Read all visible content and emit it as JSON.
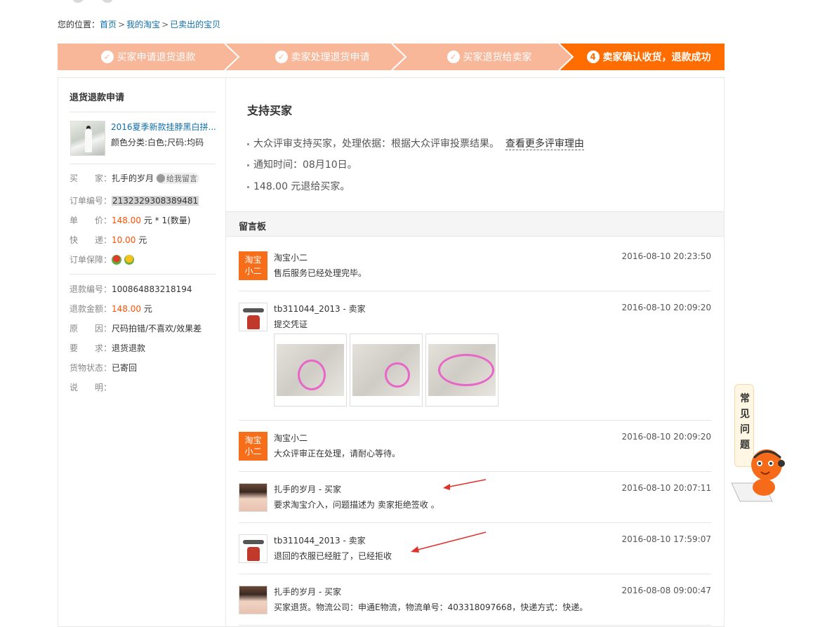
{
  "breadcrumb": {
    "prefix": "您的位置：",
    "items": [
      "首页",
      "我的淘宝",
      "已卖出的宝贝"
    ],
    "separator": ">"
  },
  "steps": [
    {
      "label": "买家申请退货退款",
      "state": "done"
    },
    {
      "label": "卖家处理退货申请",
      "state": "done"
    },
    {
      "label": "买家退货给卖家",
      "state": "done"
    },
    {
      "label": "卖家确认收货，退款成功",
      "state": "active",
      "num": "4"
    }
  ],
  "left": {
    "title": "退货退款申请",
    "product": {
      "title": "2016夏季新款挂脖黑白拼...",
      "spec": "颜色分类:白色;尺码:均码"
    },
    "buyer_label": "买　　家：",
    "buyer_value": "扎手的岁月",
    "msg_button": "给我留言",
    "order_no_label": "订单编号：",
    "order_no": "2132329308389481",
    "unit_price_label": "单　　价：",
    "unit_price": "148.00",
    "unit_price_suffix": "元 * 1(数量)",
    "shipping_label": "快　　递：",
    "shipping": "10.00",
    "shipping_suffix": "元",
    "guarantee_label": "订单保障：",
    "refund_no_label": "退款编号：",
    "refund_no": "100864883218194",
    "refund_amount_label": "退款金额：",
    "refund_amount": "148.00",
    "refund_amount_suffix": "元",
    "reason_label": "原　　因：",
    "reason": "尺码拍错/不喜欢/效果差",
    "request_label": "要　　求：",
    "request": "退货退款",
    "goods_status_label": "货物状态：",
    "goods_status": "已寄回",
    "desc_label": "说　　明：",
    "desc": ""
  },
  "result": {
    "title": "支持买家",
    "line1": "大众评审支持买家，处理依据：根据大众评审投票结果。",
    "line1_link": "查看更多评审理由",
    "line2": "通知时间：08月10日。",
    "line3": "148.00 元退给买家。"
  },
  "board": {
    "title": "留言板",
    "messages": [
      {
        "avatar": "淘宝小二",
        "avatar_l1": "淘宝",
        "avatar_l2": "小二",
        "name": "淘宝小二",
        "time": "2016-08-10 20:23:50",
        "text": "售后服务已经处理完毕。"
      },
      {
        "name": "tb311044_2013 - 卖家",
        "time": "2016-08-10 20:09:20",
        "text": "提交凭证"
      },
      {
        "avatar_l1": "淘宝",
        "avatar_l2": "小二",
        "name": "淘宝小二",
        "time": "2016-08-10 20:09:20",
        "text": "大众评审正在处理，请耐心等待。"
      },
      {
        "name": "扎手的岁月 - 买家",
        "time": "2016-08-10 20:07:11",
        "text": "要求淘宝介入，问题描述为 卖家拒绝签收 。"
      },
      {
        "name": "tb311044_2013 - 卖家",
        "time": "2016-08-10 17:59:07",
        "text": "退回的衣服已经脏了，已经拒收"
      },
      {
        "name": "扎手的岁月 - 买家",
        "time": "2016-08-08 09:00:47",
        "text": "买家退货。物流公司：申通E物流，物流单号：403318097668，快递方式：快递。"
      }
    ]
  },
  "helper": {
    "chars": [
      "常",
      "见",
      "问",
      "题"
    ]
  },
  "colors": {
    "step_done": "#f9b79a",
    "step_active": "#ff6d00",
    "link": "#0f6fa8",
    "price": "#ff5000",
    "annotation_arrow": "#e0322b"
  }
}
